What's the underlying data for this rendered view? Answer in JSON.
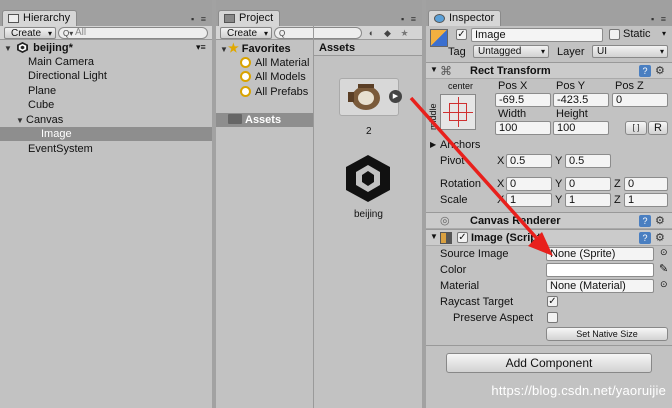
{
  "hierarchy": {
    "tab": "Hierarchy",
    "create": "Create",
    "search_placeholder": "All",
    "scene": "beijing*",
    "items": [
      "Main Camera",
      "Directional Light",
      "Plane",
      "Cube",
      "Canvas",
      "Image",
      "EventSystem"
    ]
  },
  "project": {
    "tab": "Project",
    "create": "Create",
    "favorites": "Favorites",
    "fav_items": [
      "All Material",
      "All Models",
      "All Prefabs"
    ],
    "assets_folder": "Assets",
    "assets_header": "Assets",
    "asset1": "2",
    "asset2": "beijing"
  },
  "inspector": {
    "tab": "Inspector",
    "name": "Image",
    "static": "Static",
    "tag_label": "Tag",
    "tag": "Untagged",
    "layer_label": "Layer",
    "layer": "UI",
    "rect_transform": "Rect Transform",
    "anchor_h": "center",
    "anchor_v": "middle",
    "pos_x_label": "Pos X",
    "pos_y_label": "Pos Y",
    "pos_z_label": "Pos Z",
    "pos_x": "-69.5",
    "pos_y": "-423.5",
    "pos_z": "0",
    "width_label": "Width",
    "height_label": "Height",
    "width": "100",
    "height": "100",
    "r_button": "R",
    "anchors": "Anchors",
    "pivot": "Pivot",
    "pivot_x": "0.5",
    "pivot_y": "0.5",
    "rotation": "Rotation",
    "rot_x": "0",
    "rot_y": "0",
    "rot_z": "0",
    "scale": "Scale",
    "scale_x": "1",
    "scale_y": "1",
    "scale_z": "1",
    "x": "X",
    "y": "Y",
    "z": "Z",
    "canvas_renderer": "Canvas Renderer",
    "image_script": "Image (Script)",
    "source_image_label": "Source Image",
    "source_image": "None (Sprite)",
    "color_label": "Color",
    "material_label": "Material",
    "material": "None (Material)",
    "raycast_label": "Raycast Target",
    "preserve_label": "Preserve Aspect",
    "set_native": "Set Native Size",
    "add_component": "Add Component"
  },
  "watermark": "https://blog.csdn.net/yaoruijie",
  "colors": {
    "arrow": "#e8201c",
    "accent": "#4a7fc1"
  }
}
